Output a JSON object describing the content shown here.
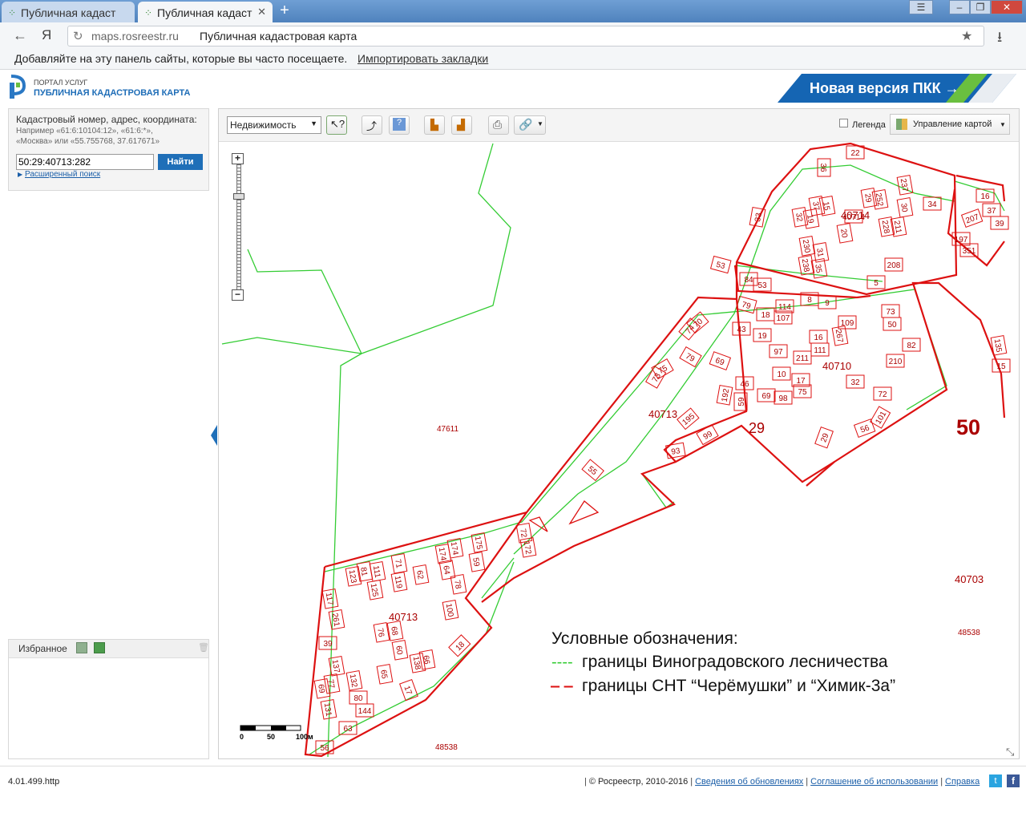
{
  "browser": {
    "tabs": [
      {
        "title": "Публичная кадаст",
        "active": false
      },
      {
        "title": "Публичная кадаст",
        "active": true
      }
    ],
    "url_domain": "maps.rosreestr.ru",
    "url_title": "Публичная кадастровая карта",
    "bookmarks_text": "Добавляйте на эту панель сайты, которые вы часто посещаете.",
    "bookmarks_link": "Импортировать закладки",
    "yandex_glyph": "Я"
  },
  "portal": {
    "small_title": "ПОРТАЛ УСЛУГ",
    "title": "ПУБЛИЧНАЯ КАДАСТРОВАЯ КАРТА",
    "new_version": "Новая версия ПКК →"
  },
  "search": {
    "label": "Кадастровый номер, адрес, координата:",
    "hint1": "Например «61:6:10104:12», «61:6:*»,",
    "hint2": "«Москва» или «55.755768, 37.617671»",
    "value": "50:29:40713:282",
    "button": "Найти",
    "advanced": "Расширенный поиск"
  },
  "favorites": {
    "title": "Избранное"
  },
  "toolbar": {
    "layer_select": "Недвижимость",
    "legend_label": "Легенда",
    "manage_label": "Управление картой"
  },
  "map": {
    "scale": {
      "labels": [
        "0",
        "50",
        "100м"
      ]
    },
    "block_labels": [
      "40714",
      "40710",
      "40713",
      "40713",
      "40703",
      "47611",
      "48538",
      "48538",
      "29",
      "50"
    ],
    "parcels": [
      "22",
      "36",
      "33",
      "53",
      "84",
      "53",
      "79",
      "43",
      "74",
      "70",
      "75",
      "73",
      "79",
      "69",
      "46",
      "59",
      "192",
      "195",
      "99",
      "93",
      "55",
      "72",
      "172",
      "175",
      "59",
      "174",
      "174",
      "64",
      "78",
      "62",
      "119",
      "71",
      "111",
      "81",
      "123",
      "125",
      "117",
      "261",
      "39",
      "137",
      "77",
      "69",
      "131",
      "132",
      "80",
      "144",
      "63",
      "56",
      "76",
      "68",
      "60",
      "138",
      "66",
      "65",
      "100",
      "18",
      "17",
      "29",
      "252",
      "237",
      "34",
      "37",
      "15",
      "32",
      "19",
      "20",
      "40714",
      "228",
      "211",
      "30",
      "230",
      "31",
      "238",
      "35",
      "208",
      "5",
      "114",
      "107",
      "18",
      "8",
      "9",
      "19",
      "97",
      "16",
      "111",
      "267",
      "109",
      "73",
      "50",
      "211",
      "17",
      "10",
      "75",
      "98",
      "69",
      "32",
      "82",
      "210",
      "72",
      "56",
      "101",
      "29",
      "16",
      "37",
      "39",
      "207",
      "197",
      "351",
      "135",
      "15"
    ],
    "legend": {
      "title": "Условные обозначения:",
      "green": "границы Виноградовского лесничества",
      "red": "границы СНТ “Черёмушки” и “Химик-3а”"
    },
    "colors": {
      "green": "#33cc33",
      "red": "#dd1111",
      "dark_red": "#aa0000"
    }
  },
  "footer": {
    "version": "4.01.499.http",
    "copyright": "© Росреестр, 2010-2016",
    "links": [
      "Сведения об обновлениях",
      "Соглашение об использовании",
      "Справка"
    ]
  }
}
